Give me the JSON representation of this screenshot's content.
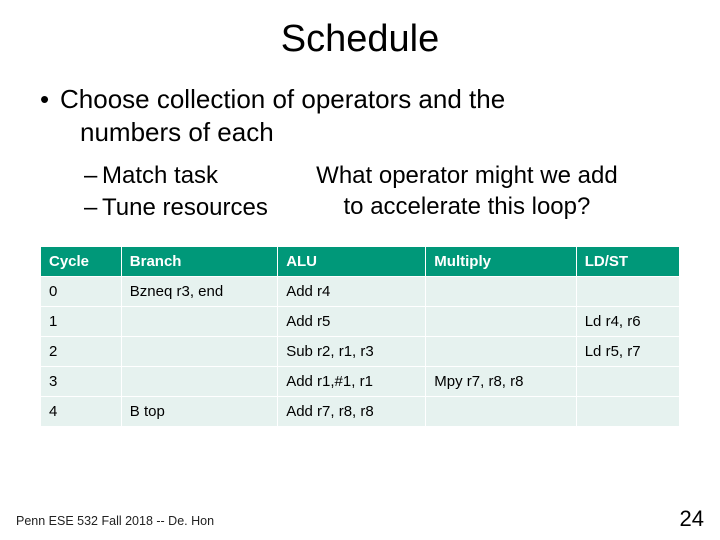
{
  "title": "Schedule",
  "bullet1_line1": "Choose collection of operators and the",
  "bullet1_line2": "numbers of each",
  "sub1": "Match task",
  "sub2": "Tune resources",
  "question_line1": "What operator might we add",
  "question_line2": "to accelerate this loop?",
  "table": {
    "headers": [
      "Cycle",
      "Branch",
      "ALU",
      "Multiply",
      "LD/ST"
    ],
    "rows": [
      [
        "0",
        "Bzneq r3, end",
        "Add r4",
        "",
        ""
      ],
      [
        "1",
        "",
        "Add r5",
        "",
        "Ld r4, r6"
      ],
      [
        "2",
        "",
        "Sub r2, r1, r3",
        "",
        "Ld r5, r7"
      ],
      [
        "3",
        "",
        "Add r1,#1, r1",
        "Mpy r7, r8, r8",
        ""
      ],
      [
        "4",
        "B top",
        "Add r7, r8, r8",
        "",
        ""
      ]
    ]
  },
  "footer": "Penn ESE 532 Fall 2018 -- De. Hon",
  "page": "24",
  "markers": {
    "dot": "•",
    "dash": "–"
  }
}
